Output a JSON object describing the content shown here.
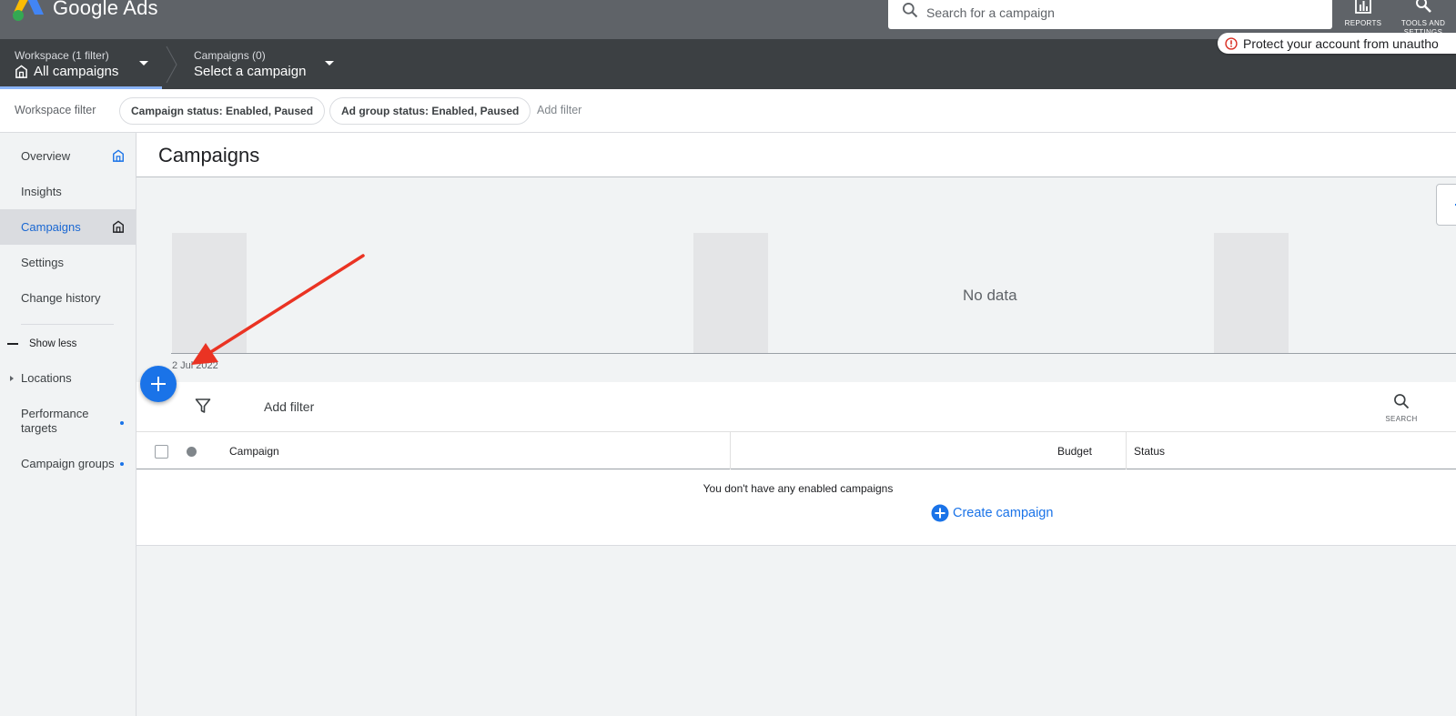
{
  "colors": {
    "header": "#5f6368",
    "subheader": "#3c4043",
    "accent": "#1a73e8",
    "annotation_arrow": "#ea3323"
  },
  "header": {
    "app_name": "Google Ads",
    "logo_icon": "google-ads-logo",
    "search": {
      "placeholder": "Search for a campaign",
      "icon": "search-icon"
    },
    "tools": [
      {
        "label": "REPORTS",
        "icon": "bar-chart-icon"
      },
      {
        "label": "TOOLS AND SETTINGS",
        "icon": "wrench-icon"
      }
    ]
  },
  "subheader": {
    "workspace": {
      "label": "Workspace (1 filter)",
      "value": "All campaigns",
      "icon": "building-icon"
    },
    "campaign_picker": {
      "label": "Campaigns (0)",
      "value": "Select a campaign"
    },
    "alert": {
      "text": "Protect your account from unautho",
      "icon": "error-icon"
    }
  },
  "filterbar": {
    "label": "Workspace filter",
    "chips": [
      "Campaign status: Enabled, Paused",
      "Ad group status: Enabled, Paused"
    ],
    "add_filter": "Add filter"
  },
  "sidebar": {
    "items": [
      {
        "label": "Overview",
        "icon": "home-outline-icon",
        "active": false
      },
      {
        "label": "Insights",
        "active": false
      },
      {
        "label": "Campaigns",
        "icon": "home-outline-icon",
        "active": true
      },
      {
        "label": "Settings",
        "active": false
      },
      {
        "label": "Change history",
        "active": false
      }
    ],
    "show_less": "Show less",
    "locations": "Locations",
    "performance_targets": "Performance targets",
    "campaign_groups": "Campaign groups"
  },
  "main": {
    "title": "Campaigns",
    "chart": {
      "no_data": "No data",
      "x_tick": "2 Jul 2022"
    },
    "table": {
      "add_filter": "Add filter",
      "search_label": "SEARCH",
      "columns": [
        "Campaign",
        "Budget",
        "Status"
      ],
      "empty_message": "You don't have any enabled campaigns",
      "create_campaign": "Create campaign"
    }
  }
}
